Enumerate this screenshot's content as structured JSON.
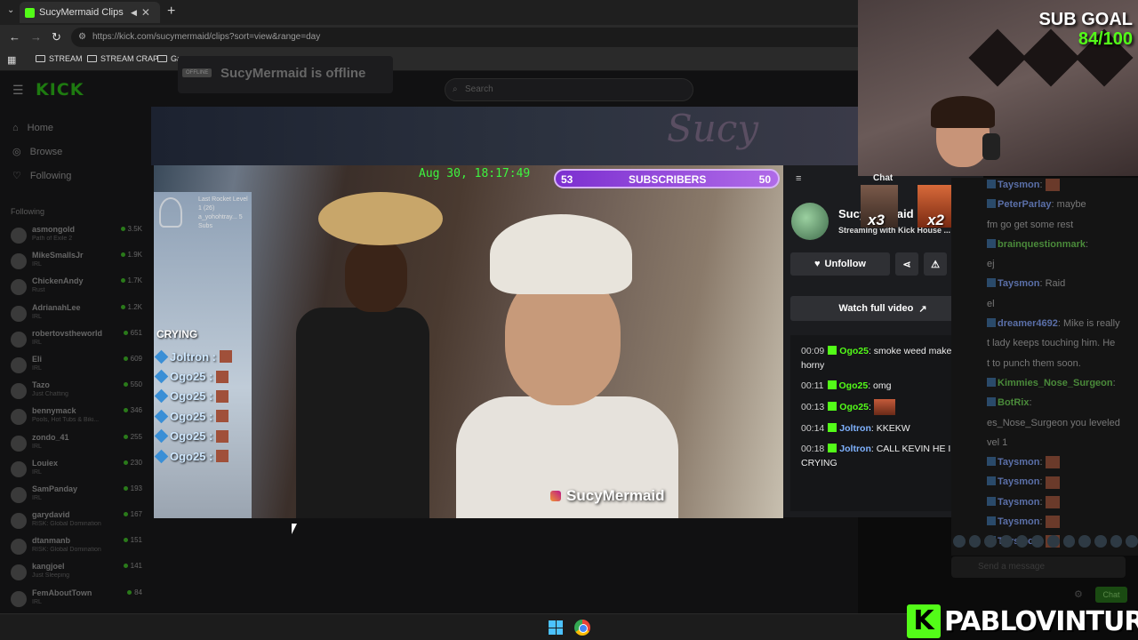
{
  "browser": {
    "tab_title": "SucyMermaid Clips - Watch",
    "tab_close": "✕",
    "new_tab": "+",
    "url": "https://kick.com/sucymermaid/clips?sort=view&range=day",
    "bookmarks": [
      "STREAM",
      "STREAM CRAP",
      "Games"
    ]
  },
  "kick": {
    "logo": "KICK",
    "search_placeholder": "Search",
    "nav": [
      {
        "label": "Home",
        "icon": "home-icon",
        "glyph": "⌂"
      },
      {
        "label": "Browse",
        "icon": "compass-icon",
        "glyph": "◎"
      },
      {
        "label": "Following",
        "icon": "heart-icon",
        "glyph": "♡"
      }
    ],
    "following_header": "Following",
    "following": [
      {
        "name": "asmongold",
        "sub": "Path of Exile 2",
        "count": "3.5K"
      },
      {
        "name": "MikeSmallsJr",
        "sub": "IRL",
        "count": "1.9K"
      },
      {
        "name": "ChickenAndy",
        "sub": "Rust",
        "count": "1.7K"
      },
      {
        "name": "AdrianahLee",
        "sub": "IRL",
        "count": "1.2K"
      },
      {
        "name": "robertovstheworld",
        "sub": "IRL",
        "count": "651"
      },
      {
        "name": "Eli",
        "sub": "IRL",
        "count": "609"
      },
      {
        "name": "Tazo",
        "sub": "Just Chatting",
        "count": "550"
      },
      {
        "name": "bennymack",
        "sub": "Pools, Hot Tubs & Biki...",
        "count": "346"
      },
      {
        "name": "zondo_41",
        "sub": "IRL",
        "count": "255"
      },
      {
        "name": "Louiex",
        "sub": "IRL",
        "count": "230"
      },
      {
        "name": "SamPanday",
        "sub": "IRL",
        "count": "193"
      },
      {
        "name": "garydavid",
        "sub": "RISK: Global Domination",
        "count": "167"
      },
      {
        "name": "dtanmanb",
        "sub": "RISK: Global Domination",
        "count": "151"
      },
      {
        "name": "kangjoel",
        "sub": "Just Sleeping",
        "count": "141"
      },
      {
        "name": "FemAboutTown",
        "sub": "IRL",
        "count": "84"
      }
    ],
    "offline_badge": "OFFLINE",
    "offline_text": "SucyMermaid is offline",
    "banner_art": "Sucy"
  },
  "video": {
    "timestamp": "Aug 30, 18:17:49",
    "sub_left": "53",
    "sub_label": "SUBSCRIBERS",
    "sub_right": "50",
    "rocket_text": "Last Rocket Level 1 (26) a_yohohtray... 5 Subs",
    "crying": "CRYING",
    "chat": [
      {
        "user": "Joltron :"
      },
      {
        "user": "Ogo25 :"
      },
      {
        "user": "Ogo25 :"
      },
      {
        "user": "Ogo25 :"
      },
      {
        "user": "Ogo25 :"
      },
      {
        "user": "Ogo25 :"
      }
    ],
    "credit": "SucyMermaid"
  },
  "clip_panel": {
    "streamer": "SucyMermaid",
    "title": "Streaming with Kick House ...",
    "unfollow": "Unfollow",
    "watch_full": "Watch full video",
    "messages": [
      {
        "time": "00:09",
        "user": "Ogo25",
        "color": "green",
        "text": ": smoke weed make horny"
      },
      {
        "time": "00:11",
        "user": "Ogo25",
        "color": "green",
        "text": ": omg"
      },
      {
        "time": "00:13",
        "user": "Ogo25",
        "color": "green",
        "text": ":",
        "emote": true
      },
      {
        "time": "00:14",
        "user": "Joltron",
        "color": "blue",
        "text": ": KKEKW"
      },
      {
        "time": "00:18",
        "user": "Joltron",
        "color": "blue",
        "text": ": CALL KEVIN HE IS CRYING"
      }
    ]
  },
  "overlay": {
    "sub_goal_label": "SUB GOAL",
    "sub_goal_value": "84/100",
    "chat_label": "Chat",
    "combo1": "x3",
    "combo2": "x2",
    "watermark": "PABLOVINTURA",
    "watermark_k": "K"
  },
  "right_chat": {
    "lines": [
      {
        "user": "Taysmon",
        "text": ":",
        "emote": true
      },
      {
        "user": "PeterParlay",
        "text": ": maybe"
      },
      {
        "user": "",
        "text": "fm go get some rest"
      },
      {
        "user": "brainquestionmark",
        "text": ":",
        "green": true
      },
      {
        "user": "",
        "text": "ej"
      },
      {
        "user": "Taysmon",
        "text": ": Raid"
      },
      {
        "user": "",
        "text": "el"
      },
      {
        "user": "dreamer4692",
        "text": ": Mike is really"
      },
      {
        "user": "",
        "text": "t lady keeps touching him. He"
      },
      {
        "user": "",
        "text": "t to punch them soon."
      },
      {
        "user": "Kimmies_Nose_Surgeon",
        "text": ":",
        "green": true
      },
      {
        "user": "BotRix",
        "text": ":",
        "green": true
      },
      {
        "user": "",
        "text": "es_Nose_Surgeon you leveled"
      },
      {
        "user": "",
        "text": "vel 1"
      },
      {
        "user": "Taysmon",
        "text": ":",
        "emote": true
      },
      {
        "user": "Taysmon",
        "text": ":",
        "emote": true
      },
      {
        "user": "Taysmon",
        "text": ":",
        "emote": true
      },
      {
        "user": "Taysmon",
        "text": ":",
        "emote": true
      },
      {
        "user": "Taysmon",
        "text": ":",
        "emote": true
      }
    ],
    "send_placeholder": "Send a message",
    "chat_button": "Chat"
  },
  "colors": {
    "kick_green": "#53fc18",
    "sub_purple": "#9b4ee0",
    "chat_blue": "#7fb2ff"
  }
}
